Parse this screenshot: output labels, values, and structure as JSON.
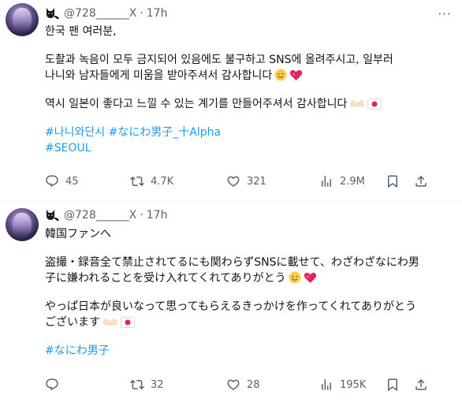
{
  "tweets": [
    {
      "handle": "@728______X",
      "separator": "·",
      "time": "17h",
      "lines": [
        "한국 팬 여러분,",
        "",
        "도촬과 녹음이 모두 금지되어 있음에도 불구하고 SNS에 올려주시고, 일부러",
        "나니와 남자들에게 미움을 받아주셔서 감사합니다",
        "",
        "역시 일본이 좋다고 느낄 수 있는 계기를 만들어주셔서 감사합니다"
      ],
      "hashtags_line1": [
        "#나니와단시",
        "#なにわ男子_十Alpha"
      ],
      "hashtags_line2": [
        "#SEOUL"
      ],
      "stats": {
        "replies": "45",
        "retweets": "4.7K",
        "likes": "321",
        "views": "2.9M"
      }
    },
    {
      "handle": "@728______X",
      "separator": "·",
      "time": "17h",
      "lines": [
        "韓国ファンへ",
        "",
        "盗撮・録音全て禁止されてるにも関わらずSNSに載せて、わざわざなにわ男",
        "子に嫌われることを受け入れてくれてありがとう",
        "",
        "やっぱ日本が良いなって思ってもらえるきっかけを作ってくれてありがとう",
        "ございます"
      ],
      "hashtags_line1": [
        "#なにわ男子"
      ],
      "stats": {
        "replies": "",
        "retweets": "32",
        "likes": "28",
        "views": "195K"
      }
    }
  ],
  "icons": {
    "cat": "cat-emoji",
    "more": "more-dots-icon",
    "reply": "reply-icon",
    "retweet": "retweet-icon",
    "like": "heart-icon",
    "views": "views-icon",
    "bookmark": "bookmark-icon",
    "share": "share-icon"
  },
  "colors": {
    "accent": "#1d9bf0",
    "text": "#0f1419",
    "muted": "#536471"
  }
}
